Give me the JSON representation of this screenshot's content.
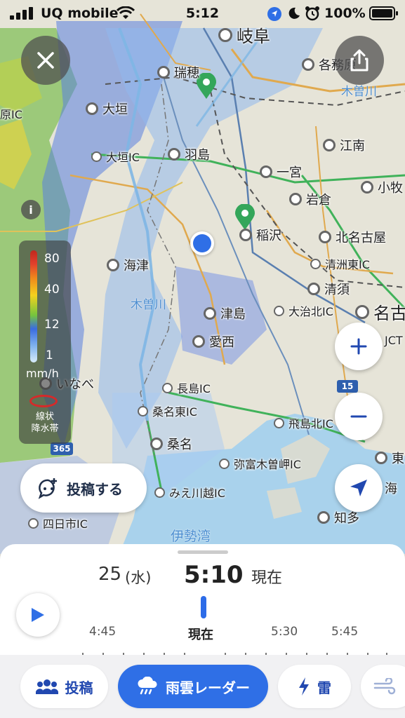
{
  "status_bar": {
    "carrier": "UQ mobile",
    "time": "5:12",
    "battery": "100%"
  },
  "map": {
    "places": {
      "gifu": "岐阜",
      "mizuho": "瑞穂",
      "kakamigahara": "各務原",
      "ogaki": "大垣",
      "hashima": "羽島",
      "konan": "江南",
      "ichinomiya": "一宮",
      "iwakura": "岩倉",
      "komaki": "小牧",
      "inazawa": "稲沢",
      "kitanagoya": "北名古屋",
      "kiyosu": "清須",
      "kaizu": "海津",
      "tsushima": "津島",
      "aisai": "愛西",
      "nagoya": "名古",
      "inabe": "いなべ",
      "kuwana": "桑名",
      "chita": "知多",
      "tokai": "東海",
      "umi": "海"
    },
    "ics": {
      "hara": "原IC",
      "ogaki_ic": "大垣IC",
      "kiyosu_higashi": "清洲東IC",
      "oharu_kita": "大治北IC",
      "nagashima": "長島IC",
      "kuwana_higashi": "桑名東IC",
      "tobishima_kita": "飛島北IC",
      "yatomi_kisosaki": "弥富木曽岬IC",
      "mie_kawagoe": "みえ川越IC",
      "yokkaichi": "四日市IC",
      "jct": "JCT"
    },
    "water": {
      "kisogawa_n": "木曽川",
      "kisogawa_s": "木曽川",
      "isewan": "伊勢湾"
    },
    "road_shields": {
      "r15": "15",
      "r365": "365"
    }
  },
  "legend": {
    "info": "i",
    "levels": [
      "80",
      "40",
      "12",
      "1"
    ],
    "unit": "mm/h",
    "linear_band_line1": "線状",
    "linear_band_line2": "降水帯",
    "colors": [
      "#c0281e",
      "#f08a1c",
      "#f4d21e",
      "#74c43e",
      "#3a6ce0",
      "#7fb2ee",
      "#d8ecfb"
    ]
  },
  "post_button": "投稿する",
  "timeline": {
    "day": "25",
    "weekday": "(水)",
    "time": "5:10",
    "now": "現在",
    "labels": [
      {
        "text": "4:45",
        "now": false
      },
      {
        "text": "現在",
        "now": true
      },
      {
        "text": "5:30",
        "now": false
      },
      {
        "text": "5:45",
        "now": false
      }
    ]
  },
  "tabs": {
    "post": "投稿",
    "radar": "雨雲レーダー",
    "thunder": "雷"
  },
  "accent_color": "#2f6fe6"
}
